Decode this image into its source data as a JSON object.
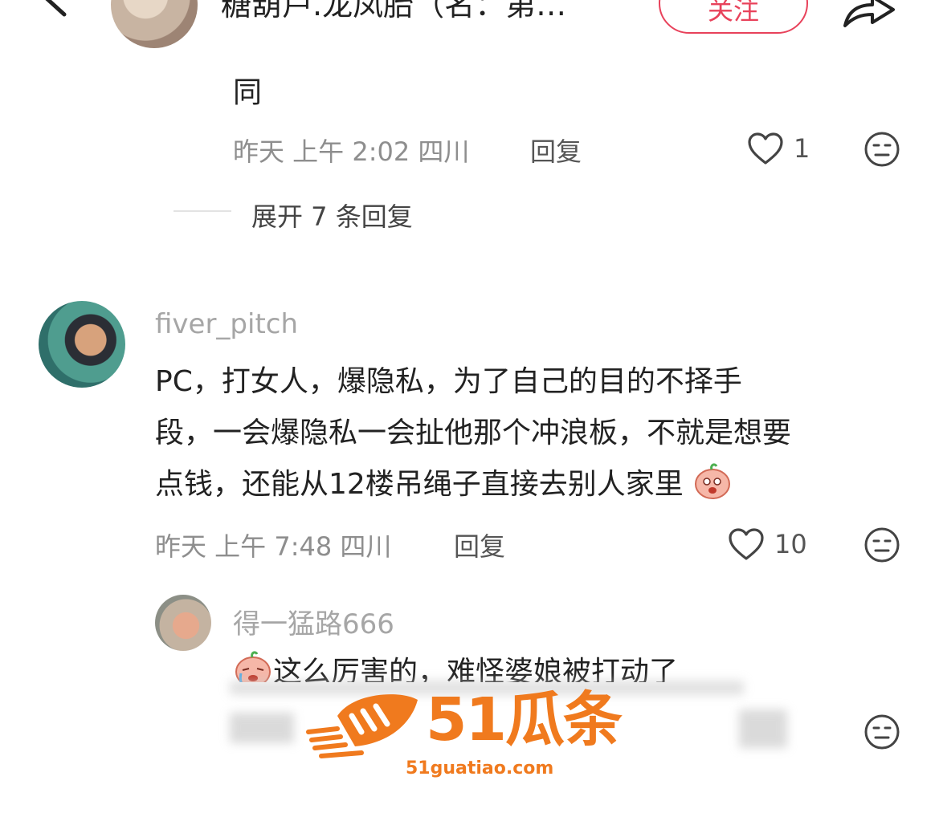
{
  "header": {
    "title": "糖葫芦.龙凤胎（名：第…",
    "follow_label": "关注"
  },
  "comment_prev": {
    "text": "同",
    "time": "昨天 上午 2:02 四川",
    "reply_label": "回复",
    "like_count": "1",
    "expand_label": "展开 7 条回复"
  },
  "comment_main": {
    "username": "fiver_pitch",
    "lines": [
      "PC，打女人，爆隐私，为了自己的目的不择手",
      "段，一会爆隐私一会扯他那个冲浪板，不就是想要",
      "点钱，还能从12楼吊绳子直接去别人家里"
    ],
    "time": "昨天 上午 7:48 四川",
    "reply_label": "回复",
    "like_count": "10"
  },
  "reply": {
    "username": "得一猛路666",
    "text": "这么厉害的，难怪婆娘被打动了"
  },
  "watermark": {
    "brand": "51瓜条",
    "url": "51guatiao.com"
  },
  "colors": {
    "accent": "#e8425b",
    "watermark": "#f07a1e",
    "meta": "#8e8e8e"
  },
  "icons": [
    "back-icon",
    "share-icon",
    "heart-icon",
    "dislike-face-icon",
    "emoji-sticker-icon"
  ]
}
